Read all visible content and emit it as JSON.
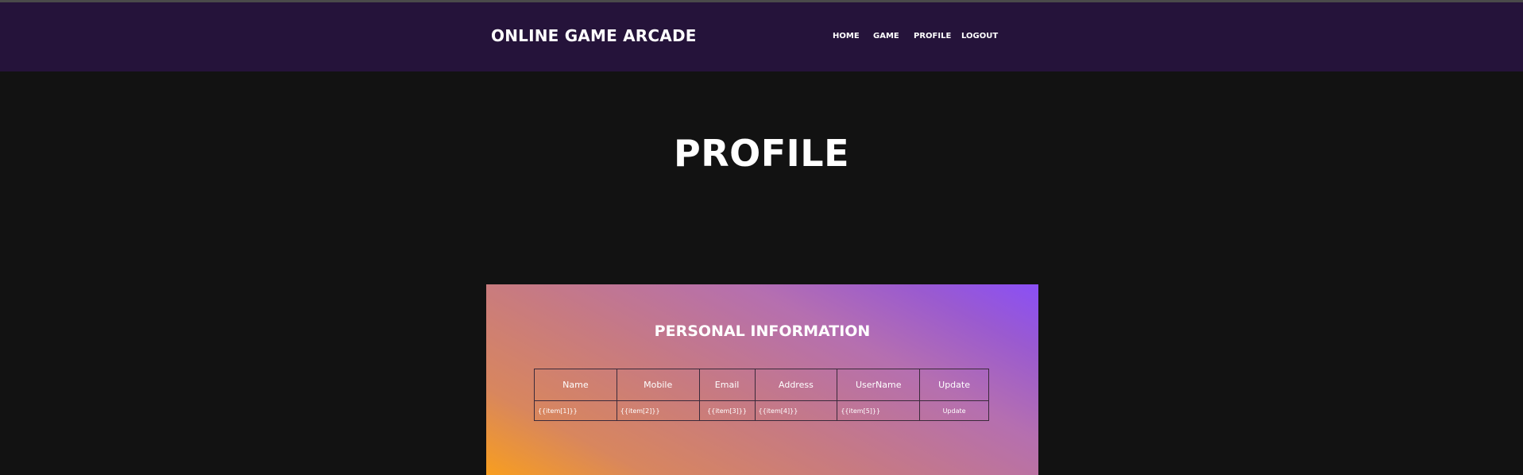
{
  "navbar": {
    "brand": "ONLINE GAME ARCADE",
    "links": [
      "HOME",
      "GAME",
      "PROFILE",
      "LOGOUT"
    ]
  },
  "page": {
    "title": "PROFILE"
  },
  "card": {
    "title": "PERSONAL INFORMATION",
    "table": {
      "headers": [
        "Name",
        "Mobile",
        "Email",
        "Address",
        "UserName",
        "Update"
      ],
      "row": [
        "{{item[1]}}",
        "{{item[2]}}",
        "{{item[3]}}",
        "{{item[4]}}",
        "{{item[5]}}"
      ],
      "update_label": "Update"
    }
  },
  "colors": {
    "navbar_bg": "#25133a",
    "page_bg": "#121212",
    "gradient_start": "#f89e1f",
    "gradient_end": "#8a4ff6"
  }
}
